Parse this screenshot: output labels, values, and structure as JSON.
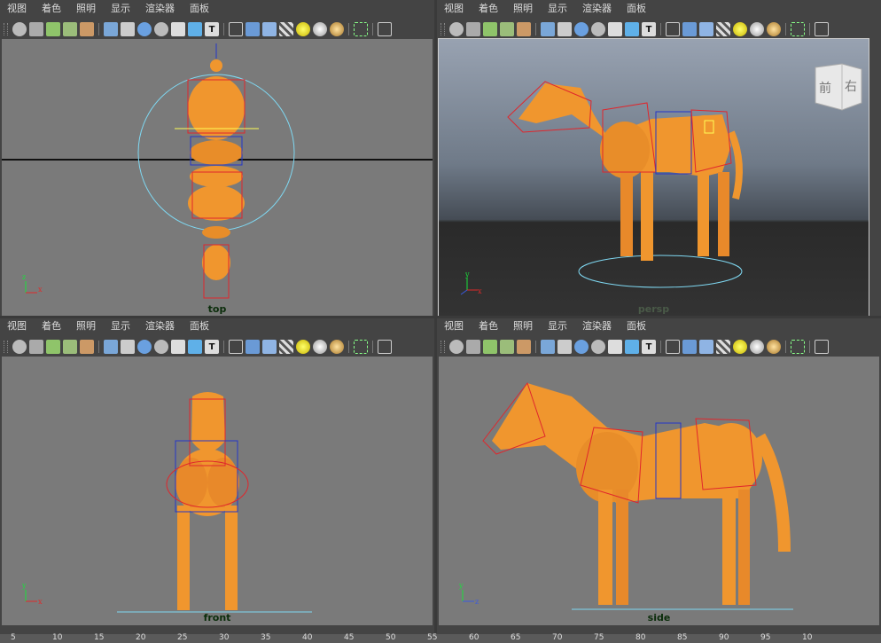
{
  "menu": [
    "视图",
    "着色",
    "照明",
    "显示",
    "渲染器",
    "面板"
  ],
  "viewports": {
    "top": {
      "label": "top"
    },
    "persp": {
      "label": "persp"
    },
    "front": {
      "label": "front"
    },
    "side": {
      "label": "side"
    }
  },
  "view_cube": {
    "front_label": "前",
    "right_label": "右"
  },
  "axis": {
    "x": "x",
    "y": "y",
    "z": "z"
  },
  "ruler": {
    "ticks": [
      "5",
      "10",
      "15",
      "20",
      "25",
      "30",
      "35",
      "40",
      "45",
      "50",
      "55",
      "60",
      "65",
      "70",
      "75",
      "80",
      "85",
      "90",
      "95",
      "10"
    ]
  },
  "colors": {
    "model": "#f0962e",
    "rig_red": "#e0262c",
    "rig_blue": "#2435c8",
    "select_cyan": "#7fd8f2",
    "viewport_bg": "#7a7a7a"
  }
}
